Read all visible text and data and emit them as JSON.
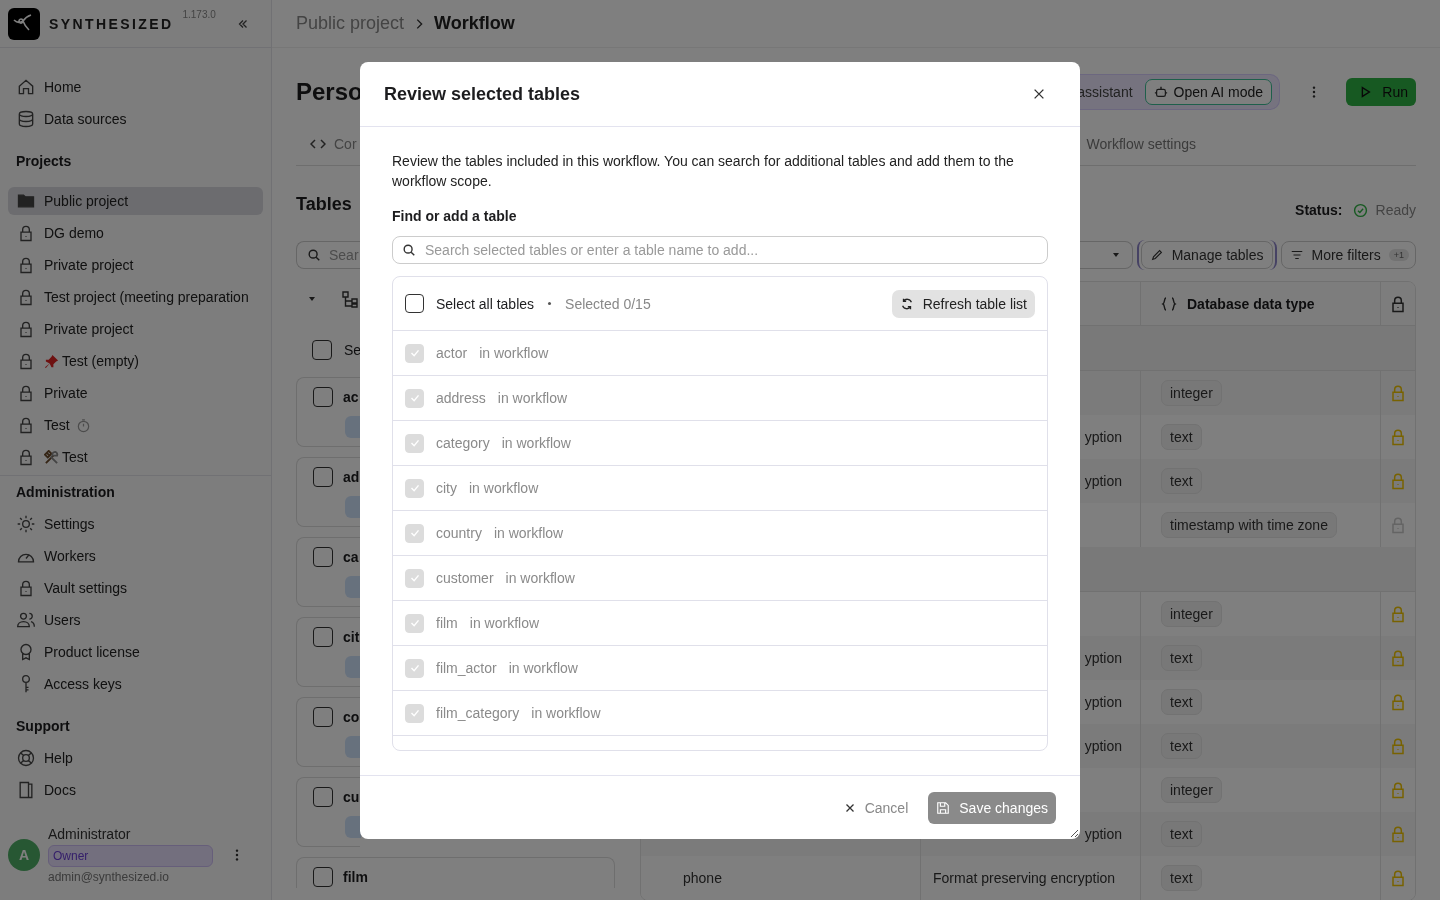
{
  "sidebar": {
    "brand": "SYNTHESIZED",
    "version": "1.173.0",
    "nav": [
      {
        "label": "Home",
        "kind": "home"
      },
      {
        "label": "Data sources",
        "kind": "database"
      }
    ],
    "projects_heading": "Projects",
    "projects": [
      {
        "label": "Public project",
        "kind": "folder",
        "selected": true
      },
      {
        "label": "DG demo",
        "kind": "lock",
        "selected": false
      },
      {
        "label": "Private project",
        "kind": "lock",
        "selected": false
      },
      {
        "label": "Test project (meeting preparation",
        "kind": "lock",
        "selected": false
      },
      {
        "label": "Private project",
        "kind": "lock",
        "selected": false
      },
      {
        "label": "Test (empty)",
        "kind": "lock",
        "badge_before": {
          "kind": "pin"
        },
        "selected": false
      },
      {
        "label": "Private",
        "kind": "lock",
        "selected": false
      },
      {
        "label": "Test",
        "kind": "lock",
        "badge_after": {
          "kind": "stopwatch"
        },
        "selected": false
      },
      {
        "label": "Test",
        "kind": "lock",
        "badge_before": {
          "kind": "tools"
        },
        "selected": false
      }
    ],
    "admin_heading": "Administration",
    "admin": [
      {
        "label": "Settings",
        "kind": "gear"
      },
      {
        "label": "Workers",
        "kind": "gauge"
      },
      {
        "label": "Vault settings",
        "kind": "lock"
      },
      {
        "label": "Users",
        "kind": "users"
      },
      {
        "label": "Product license",
        "kind": "award"
      },
      {
        "label": "Access keys",
        "kind": "key"
      }
    ],
    "support_heading": "Support",
    "support": [
      {
        "label": "Help",
        "kind": "lifebuoy"
      },
      {
        "label": "Docs",
        "kind": "book"
      }
    ],
    "user": {
      "initial": "A",
      "name": "Administrator",
      "role": "Owner",
      "email": "admin@synthesized.io"
    }
  },
  "breadcrumb": [
    {
      "label": "Public project",
      "current": false
    },
    {
      "label": "Workflow",
      "current": true
    }
  ],
  "page_left": {
    "title": "Perso",
    "tab": "Cor",
    "section": "Tables",
    "search": "Sear",
    "select": {
      "label": "Se",
      "checked": false
    },
    "cards": [
      {
        "name": "ac",
        "checked": false
      },
      {
        "name": "ad",
        "checked": false
      },
      {
        "name": "ca",
        "checked": false
      },
      {
        "name": "cit",
        "checked": false
      },
      {
        "name": "co",
        "checked": false
      },
      {
        "name": "cu",
        "checked": false
      },
      {
        "name": "film",
        "checked": false
      }
    ]
  },
  "page_right": {
    "ai_label": "assistant",
    "ai_button": "Open AI mode",
    "run": "Run",
    "tab": "Workflow settings",
    "status_label": "Status:",
    "status": "Ready",
    "manage": "Manage tables",
    "filters": "More filters",
    "filter_count": "+1",
    "column": "Database data type",
    "rows": [
      {
        "kind": "group"
      },
      {
        "kind": "column",
        "type": "integer",
        "locked": true
      },
      {
        "kind": "column",
        "encryption_tail": "yption",
        "type": "text",
        "locked": true
      },
      {
        "kind": "column",
        "encryption_tail": "yption",
        "type": "text",
        "locked": true
      },
      {
        "kind": "column",
        "type": "timestamp with time zone",
        "locked": false
      },
      {
        "kind": "group"
      },
      {
        "kind": "column",
        "type": "integer",
        "locked": true
      },
      {
        "kind": "column",
        "encryption_tail": "yption",
        "type": "text",
        "locked": true
      },
      {
        "kind": "column",
        "encryption_tail": "yption",
        "type": "text",
        "locked": true
      },
      {
        "kind": "column",
        "encryption_tail": "yption",
        "type": "text",
        "locked": true
      },
      {
        "kind": "column",
        "type": "integer",
        "locked": true
      },
      {
        "kind": "column",
        "encryption_tail": "yption",
        "type": "text",
        "locked": true
      },
      {
        "kind": "column",
        "name": "phone",
        "encryption": "Format preserving encryption",
        "type": "text",
        "locked": true
      }
    ]
  },
  "modal": {
    "title": "Review selected tables",
    "description": "Review the tables included in this workflow. You can search for additional tables and add them to the workflow scope.",
    "search_label": "Find or add a table",
    "search_placeholder": "Search selected tables or enter a table name to add...",
    "select_all": {
      "label": "Select all tables",
      "checked": false
    },
    "selected_count": "Selected 0/15",
    "refresh": "Refresh table list",
    "tables": [
      {
        "name": "actor",
        "note": "in workflow",
        "checked": true,
        "disabled": true
      },
      {
        "name": "address",
        "note": "in workflow",
        "checked": true,
        "disabled": true
      },
      {
        "name": "category",
        "note": "in workflow",
        "checked": true,
        "disabled": true
      },
      {
        "name": "city",
        "note": "in workflow",
        "checked": true,
        "disabled": true
      },
      {
        "name": "country",
        "note": "in workflow",
        "checked": true,
        "disabled": true
      },
      {
        "name": "customer",
        "note": "in workflow",
        "checked": true,
        "disabled": true
      },
      {
        "name": "film",
        "note": "in workflow",
        "checked": true,
        "disabled": true
      },
      {
        "name": "film_actor",
        "note": "in workflow",
        "checked": true,
        "disabled": true
      },
      {
        "name": "film_category",
        "note": "in workflow",
        "checked": true,
        "disabled": true
      }
    ],
    "cancel": "Cancel",
    "save": {
      "label": "Save changes",
      "disabled": true
    }
  }
}
